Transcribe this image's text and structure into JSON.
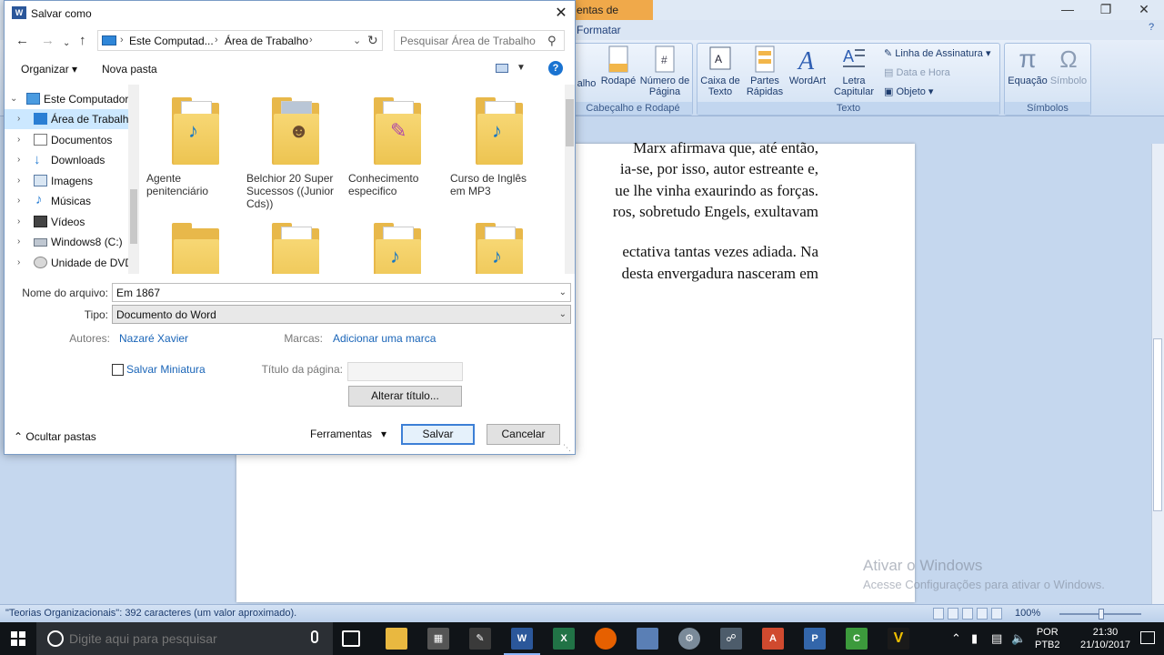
{
  "word": {
    "context_tab_title": "entas de Imagem",
    "tab_formatar": "Formatar",
    "ribbon": {
      "groups": [
        {
          "label": "Cabeçalho e Rodapé"
        },
        {
          "label": "Texto"
        },
        {
          "label": "Símbolos"
        }
      ],
      "buttons": {
        "cabecalho": "alho",
        "rodape": "Rodapé",
        "numero_pagina_1": "Número de",
        "numero_pagina_2": "Página",
        "caixa_texto_1": "Caixa de",
        "caixa_texto_2": "Texto",
        "partes_rapidas_1": "Partes",
        "partes_rapidas_2": "Rápidas",
        "wordart": "WordArt",
        "letra_capitular_1": "Letra",
        "letra_capitular_2": "Capitular",
        "linha_assinatura": "Linha de Assinatura",
        "data_hora": "Data e Hora",
        "objeto": "Objeto",
        "equacao": "Equação",
        "simbolo": "Símbolo"
      }
    },
    "document_lines": [
      "Marx afirmava que, até então,",
      "ia-se, por isso, autor estreante e,",
      "ue lhe vinha exaurindo as forças.",
      "ros, sobretudo Engels, exultavam",
      "",
      "ectativa tantas vezes adiada. Na",
      "desta envergadura nasceram em"
    ],
    "watermark_title": "Ativar o Windows",
    "watermark_sub": "Acesse Configurações para ativar o Windows.",
    "status_text": "\"Teorias Organizacionais\": 392 caracteres (um valor aproximado).",
    "zoom": "100%"
  },
  "dialog": {
    "title": "Salvar como",
    "address": [
      "Este Computad...",
      "Área de Trabalho"
    ],
    "search_placeholder": "Pesquisar Área de Trabalho",
    "toolbar": {
      "organizar": "Organizar",
      "nova_pasta": "Nova pasta"
    },
    "tree": [
      {
        "label": "Este Computador",
        "icon": "computer-icon"
      },
      {
        "label": "Área de Trabalho",
        "icon": "desktop-icon"
      },
      {
        "label": "Documentos",
        "icon": "documents-icon"
      },
      {
        "label": "Downloads",
        "icon": "download-icon"
      },
      {
        "label": "Imagens",
        "icon": "images-icon"
      },
      {
        "label": "Músicas",
        "icon": "music-icon"
      },
      {
        "label": "Vídeos",
        "icon": "video-icon"
      },
      {
        "label": "Windows8 (C:)",
        "icon": "drive-icon"
      },
      {
        "label": "Unidade de DVD",
        "icon": "dvd-icon"
      }
    ],
    "files": [
      {
        "label": "Agente penitenciário"
      },
      {
        "label": "Belchior 20 Super Sucessos ((Junior Cds))"
      },
      {
        "label": "Conhecimento especifico"
      },
      {
        "label": "Curso de Inglês  em  MP3"
      },
      {
        "label": ""
      },
      {
        "label": ""
      },
      {
        "label": ""
      },
      {
        "label": ""
      }
    ],
    "form": {
      "nome_label": "Nome do arquivo:",
      "nome_value": "Em 1867",
      "tipo_label": "Tipo:",
      "tipo_value": "Documento do Word",
      "autores_label": "Autores:",
      "autores_value": "Nazaré Xavier",
      "marcas_label": "Marcas:",
      "marcas_value": "Adicionar uma marca",
      "miniatura_label": "Salvar Miniatura",
      "titulo_label": "Título da página:",
      "alterar_titulo": "Alterar título..."
    },
    "footer": {
      "ocultar": "Ocultar pastas",
      "ferramentas": "Ferramentas",
      "salvar": "Salvar",
      "cancelar": "Cancelar"
    }
  },
  "taskbar": {
    "search_placeholder": "Digite aqui para pesquisar",
    "lang_1": "POR",
    "lang_2": "PTB2",
    "time": "21:30",
    "date": "21/10/2017"
  }
}
